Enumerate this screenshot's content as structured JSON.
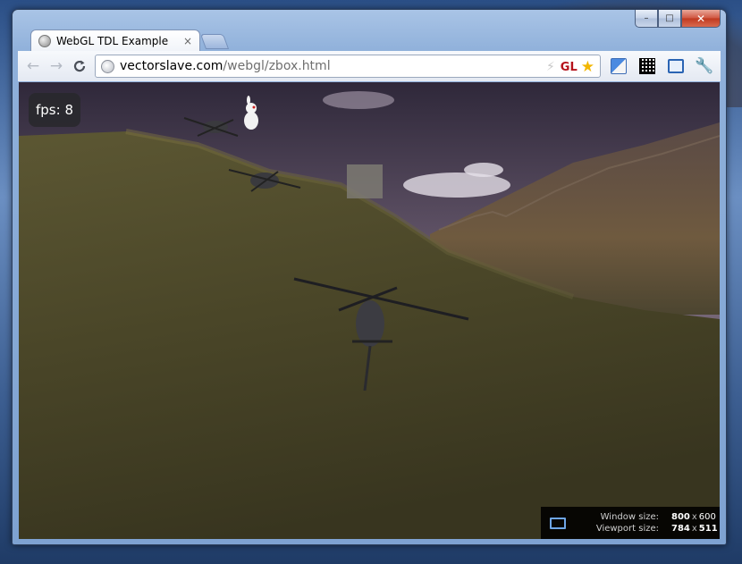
{
  "window": {
    "tab_title": "WebGL TDL Example",
    "tab_close": "×",
    "caption": {
      "minimize": "–",
      "maximize": "□",
      "close": "✕"
    }
  },
  "toolbar": {
    "back": "←",
    "forward": "→",
    "reload": "C",
    "url_host": "vectorslave.com",
    "url_path": "/webgl/zbox.html",
    "gl_badge": "GL",
    "star": "★",
    "bolt": "⚡",
    "wrench": "🔧"
  },
  "overlay": {
    "fps": "fps: 8",
    "window_size_label": "Window size:",
    "window_size_w": "800",
    "window_size_h": "600",
    "viewport_size_label": "Viewport size:",
    "viewport_size_w": "784",
    "viewport_size_h": "511",
    "times": "x"
  },
  "colors": {
    "accent": "#2a64b3",
    "gl_red": "#b5121b",
    "star_gold": "#f2b600"
  }
}
